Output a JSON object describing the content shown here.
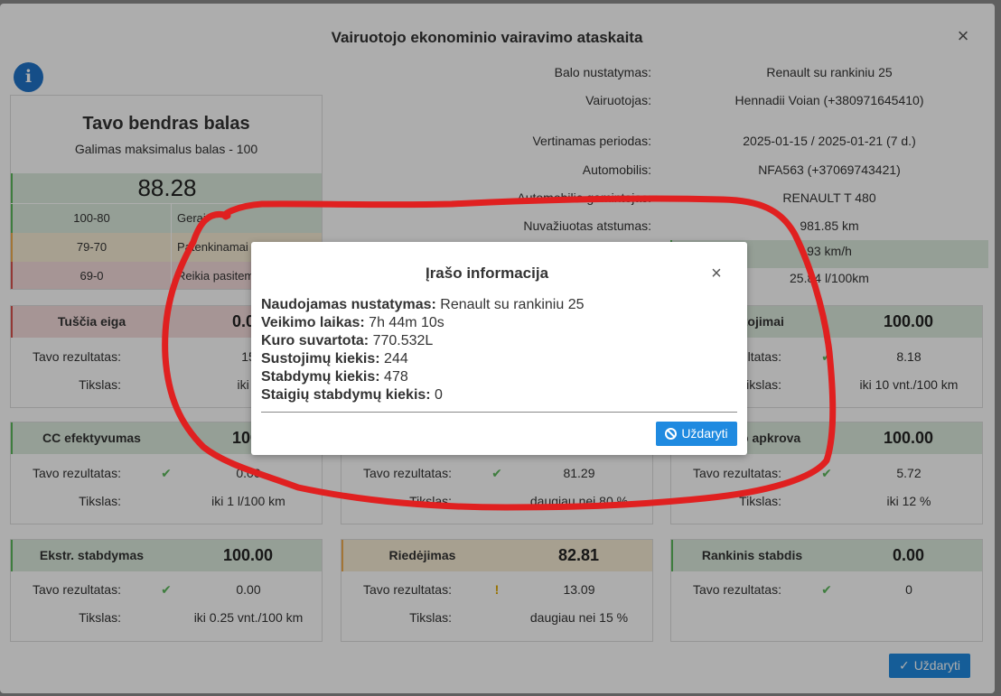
{
  "modal": {
    "title": "Vairuotojo ekonominio vairavimo ataskaita",
    "close_icon": "×"
  },
  "info_icon": "i",
  "score": {
    "title": "Tavo bendras balas",
    "subtitle": "Galimas maksimalus balas - 100",
    "value": "88.28",
    "legend": [
      {
        "range": "100-80",
        "label": "Gerai"
      },
      {
        "range": "79-70",
        "label": "Patenkinamai"
      },
      {
        "range": "69-0",
        "label": "Reikia pasitempti"
      }
    ]
  },
  "details": [
    {
      "label": "Balo nustatymas:",
      "value": "Renault su rankiniu 25"
    },
    {
      "label": "Vairuotojas:",
      "value": "Hennadii Voian (+380971645410)"
    },
    {
      "label": "Vertinamas periodas:",
      "value": "2025-01-15  /  2025-01-21 (7 d.)"
    },
    {
      "label": "Automobilis:",
      "value": "NFA563 (+37069743421)"
    },
    {
      "label": "Automobilio gamintojas:",
      "value": "RENAULT T 480"
    },
    {
      "label": "Nuvažiuotas atstumas:",
      "value": "981.85 km"
    },
    {
      "label": "",
      "value": "93 km/h"
    },
    {
      "label": "",
      "value": "25.84 l/100km"
    }
  ],
  "metrics": [
    {
      "name": "Tuščia eiga",
      "score": "0.00",
      "result_label": "Tavo rezultatas:",
      "result": "15",
      "target_label": "Tikslas:",
      "target": "iki 9"
    },
    {
      "name": "",
      "score": "",
      "result_label": "",
      "result": "",
      "target_label": "",
      "target": ""
    },
    {
      "name": "Sustojimai",
      "score": "100.00",
      "result_label": "Tavo rezultatas:",
      "result": "8.18",
      "target_label": "Tikslas:",
      "target": "iki 10 vnt./100 km"
    },
    {
      "name": "CC efektyvumas",
      "score": "100.",
      "result_label": "Tavo rezultatas:",
      "result": "0.00",
      "target_label": "Tikslas:",
      "target": "iki 1 l/100 km"
    },
    {
      "name": "",
      "score": "",
      "result_label": "Tavo rezultatas:",
      "result": "81.29",
      "target_label": "Tikslas:",
      "target": "daugiau nei 80 %"
    },
    {
      "name": "Variklio apkrova",
      "score": "100.00",
      "result_label": "Tavo rezultatas:",
      "result": "5.72",
      "target_label": "Tikslas:",
      "target": "iki 12 %"
    },
    {
      "name": "Ekstr. stabdymas",
      "score": "100.00",
      "result_label": "Tavo rezultatas:",
      "result": "0.00",
      "target_label": "Tikslas:",
      "target": "iki 0.25 vnt./100 km"
    },
    {
      "name": "Riedėjimas",
      "score": "82.81",
      "result_label": "Tavo rezultatas:",
      "result": "13.09",
      "target_label": "Tikslas:",
      "target": "daugiau nei 15 %"
    },
    {
      "name": "Rankinis stabdis",
      "score": "0.00",
      "result_label": "Tavo rezultatas:",
      "result": "0",
      "target_label": "",
      "target": ""
    }
  ],
  "bottom_close_label": "Uždaryti",
  "dialog": {
    "title": "Įrašo informacija",
    "lines": [
      {
        "label": "Naudojamas nustatymas:",
        "value": " Renault su rankiniu 25"
      },
      {
        "label": "Veikimo laikas:",
        "value": " 7h 44m 10s"
      },
      {
        "label": "Kuro suvartota:",
        "value": " 770.532L"
      },
      {
        "label": "Sustojimų kiekis:",
        "value": " 244"
      },
      {
        "label": "Stabdymų kiekis:",
        "value": " 478"
      },
      {
        "label": "Staigių stabdymų kiekis:",
        "value": " 0"
      }
    ],
    "close_label": "Uždaryti"
  },
  "colors": {
    "accent": "#1f8ae0",
    "good": "#5cb85c",
    "warn": "#f0ad4e",
    "bad": "#d9534f",
    "annotation": "#e02020"
  },
  "icons": {
    "check": "check-icon",
    "warning": "exclamation-icon",
    "ban": "ban-icon",
    "close": "close-icon",
    "info": "info-icon"
  }
}
